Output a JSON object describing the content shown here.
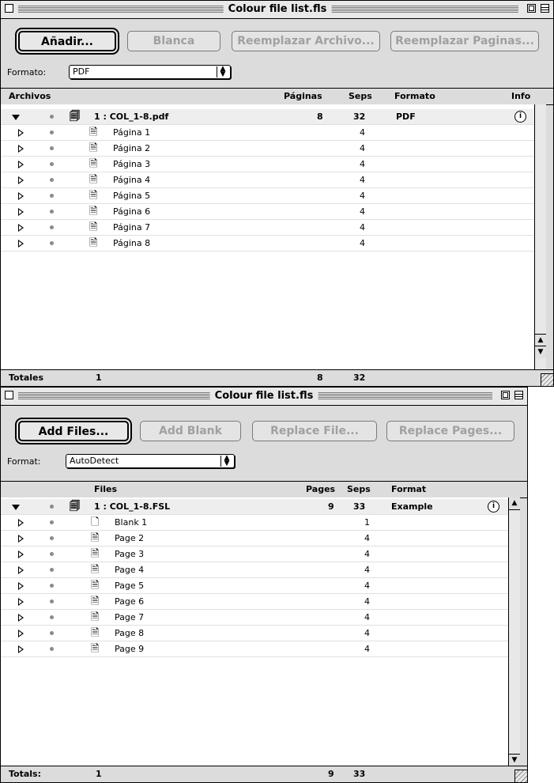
{
  "windows": [
    {
      "title": "Colour file list.fls",
      "buttons": {
        "add": "Añadir...",
        "blank": "Blanca",
        "replace_file": "Reemplazar Archivo...",
        "replace_pages": "Reemplazar Paginas..."
      },
      "format_label": "Formato:",
      "format_value": "PDF",
      "columns": {
        "files": "Archivos",
        "pages": "Páginas",
        "seps": "Seps",
        "format": "Formato",
        "info": "Info"
      },
      "parent": {
        "name": "1 : COL_1-8.pdf",
        "pages": "8",
        "seps": "32",
        "format": "PDF"
      },
      "rows": [
        {
          "name": "Página 1",
          "seps": "4"
        },
        {
          "name": "Página 2",
          "seps": "4"
        },
        {
          "name": "Página 3",
          "seps": "4"
        },
        {
          "name": "Página 4",
          "seps": "4"
        },
        {
          "name": "Página 5",
          "seps": "4"
        },
        {
          "name": "Página 6",
          "seps": "4"
        },
        {
          "name": "Página 7",
          "seps": "4"
        },
        {
          "name": "Página 8",
          "seps": "4"
        }
      ],
      "totals": {
        "label": "Totales",
        "files": "1",
        "pages": "8",
        "seps": "32"
      }
    },
    {
      "title": "Colour file list.fls",
      "buttons": {
        "add": "Add Files...",
        "blank": "Add Blank",
        "replace_file": "Replace File...",
        "replace_pages": "Replace Pages..."
      },
      "format_label": "Format:",
      "format_value": "AutoDetect",
      "columns": {
        "files": "Files",
        "pages": "Pages",
        "seps": "Seps",
        "format": "Format"
      },
      "parent": {
        "name": "1 : COL_1-8.FSL",
        "pages": "9",
        "seps": "33",
        "format": "Example"
      },
      "rows": [
        {
          "name": "Blank 1",
          "seps": "1",
          "icon": "blank-page-icon"
        },
        {
          "name": "Page 2",
          "seps": "4"
        },
        {
          "name": "Page 3",
          "seps": "4"
        },
        {
          "name": "Page 4",
          "seps": "4"
        },
        {
          "name": "Page 5",
          "seps": "4"
        },
        {
          "name": "Page 6",
          "seps": "4"
        },
        {
          "name": "Page 7",
          "seps": "4"
        },
        {
          "name": "Page 8",
          "seps": "4"
        },
        {
          "name": "Page 9",
          "seps": "4"
        }
      ],
      "totals": {
        "label": "Totals:",
        "files": "1",
        "pages": "9",
        "seps": "33"
      }
    }
  ],
  "icons": {
    "close": "close-box-icon",
    "zoom": "zoom-box-icon",
    "collapse": "windowshade-icon",
    "expand": "disclosure-triangle-icon",
    "stack": "document-stack-icon",
    "page": "page-icon",
    "info": "info-icon"
  }
}
